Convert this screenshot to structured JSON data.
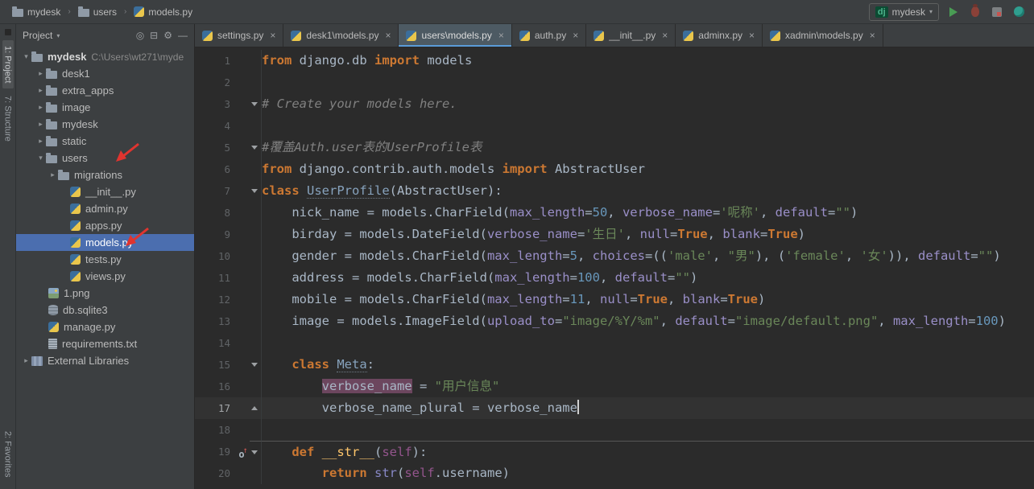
{
  "colors": {
    "panel_bg": "#3c3f41",
    "editor_bg": "#2b2b2b",
    "selection_blue": "#4b6eaf",
    "tab_underline": "#5a9bd8",
    "keyword": "#cc7832",
    "string": "#6a8759",
    "comment": "#808080",
    "number": "#6897bb",
    "kwarg": "#9a8fc8",
    "annotation_red": "#e0342f",
    "occurrence_highlight": "#e678be"
  },
  "ui": {
    "breadcrumb_separator": "›",
    "tab_close": "×",
    "chevron_expanded": "▾",
    "chevron_collapsed": "▸",
    "dropdown_arrow": "▾"
  },
  "top_bar": {
    "breadcrumbs": [
      {
        "label": "mydesk",
        "icon": "folder"
      },
      {
        "label": "users",
        "icon": "folder"
      },
      {
        "label": "models.py",
        "icon": "python"
      }
    ],
    "run_config": {
      "badge": "dj",
      "label": "mydesk"
    },
    "actions": [
      {
        "name": "run"
      },
      {
        "name": "debug"
      },
      {
        "name": "coverage"
      },
      {
        "name": "profiler"
      }
    ]
  },
  "tool_stripe": {
    "top": [
      "1: Project",
      "7: Structure"
    ],
    "bottom": [
      "2: Favorites"
    ]
  },
  "project_panel": {
    "title": "Project",
    "header_icons": [
      "locate",
      "collapse-all",
      "settings",
      "hide"
    ],
    "tree": [
      {
        "label": "mydesk",
        "suffix": "C:\\Users\\wt271\\myde",
        "pad": 6,
        "chev": "open",
        "icon": "folder",
        "bold": true
      },
      {
        "label": "desk1",
        "pad": 24,
        "chev": "closed",
        "icon": "folder"
      },
      {
        "label": "extra_apps",
        "pad": 24,
        "chev": "closed",
        "icon": "folder"
      },
      {
        "label": "image",
        "pad": 24,
        "chev": "closed",
        "icon": "folder"
      },
      {
        "label": "mydesk",
        "pad": 24,
        "chev": "closed",
        "icon": "folder"
      },
      {
        "label": "static",
        "pad": 24,
        "chev": "closed",
        "icon": "folder"
      },
      {
        "label": "users",
        "pad": 24,
        "chev": "open",
        "icon": "folder"
      },
      {
        "label": "migrations",
        "pad": 39,
        "chev": "closed",
        "icon": "folder"
      },
      {
        "label": "__init__.py",
        "pad": 67,
        "icon": "python"
      },
      {
        "label": "admin.py",
        "pad": 67,
        "icon": "python"
      },
      {
        "label": "apps.py",
        "pad": 67,
        "icon": "python"
      },
      {
        "label": "models.py",
        "pad": 67,
        "icon": "python",
        "selected": true
      },
      {
        "label": "tests.py",
        "pad": 67,
        "icon": "python"
      },
      {
        "label": "views.py",
        "pad": 67,
        "icon": "python"
      },
      {
        "label": "1.png",
        "pad": 40,
        "icon": "image"
      },
      {
        "label": "db.sqlite3",
        "pad": 40,
        "icon": "database"
      },
      {
        "label": "manage.py",
        "pad": 40,
        "icon": "python"
      },
      {
        "label": "requirements.txt",
        "pad": 40,
        "icon": "text"
      },
      {
        "label": "External Libraries",
        "pad": 6,
        "chev": "closed",
        "icon": "library"
      }
    ]
  },
  "tabs": [
    {
      "label": "settings.py"
    },
    {
      "label": "desk1\\models.py"
    },
    {
      "label": "users\\models.py",
      "active": true
    },
    {
      "label": "auth.py"
    },
    {
      "label": "__init__.py"
    },
    {
      "label": "adminx.py"
    },
    {
      "label": "xadmin\\models.py"
    }
  ],
  "editor": {
    "lines": [
      {
        "n": 1,
        "t": [
          [
            "k",
            "from"
          ],
          [
            "p",
            " django.db "
          ],
          [
            "k",
            "import"
          ],
          [
            "p",
            " models"
          ]
        ]
      },
      {
        "n": 2,
        "t": []
      },
      {
        "n": 3,
        "fold": "down",
        "t": [
          [
            "c",
            "# Create your models here."
          ]
        ]
      },
      {
        "n": 4,
        "t": []
      },
      {
        "n": 5,
        "fold": "down",
        "t": [
          [
            "c",
            "#覆盖Auth.user表的UserProfile表"
          ]
        ]
      },
      {
        "n": 6,
        "t": [
          [
            "k",
            "from"
          ],
          [
            "p",
            " django.contrib.auth.models "
          ],
          [
            "k",
            "import"
          ],
          [
            "p",
            " AbstractUser"
          ]
        ]
      },
      {
        "n": 7,
        "fold": "down",
        "t": [
          [
            "k",
            "class"
          ],
          [
            "p",
            " "
          ],
          [
            "cd",
            "UserProfile"
          ],
          [
            "p",
            "(AbstractUser):"
          ]
        ]
      },
      {
        "n": 8,
        "t": [
          [
            "p",
            "    nick_name = models.CharField("
          ],
          [
            "a",
            "max_length"
          ],
          [
            "p",
            "="
          ],
          [
            "n",
            "50"
          ],
          [
            "p",
            ", "
          ],
          [
            "a",
            "verbose_name"
          ],
          [
            "p",
            "="
          ],
          [
            "s",
            "'呢称'"
          ],
          [
            "p",
            ", "
          ],
          [
            "a",
            "default"
          ],
          [
            "p",
            "="
          ],
          [
            "s",
            "\"\""
          ],
          [
            "p",
            ")"
          ]
        ]
      },
      {
        "n": 9,
        "t": [
          [
            "p",
            "    birday = models.DateField("
          ],
          [
            "a",
            "verbose_name"
          ],
          [
            "p",
            "="
          ],
          [
            "s",
            "'生日'"
          ],
          [
            "p",
            ", "
          ],
          [
            "a",
            "null"
          ],
          [
            "p",
            "="
          ],
          [
            "k",
            "True"
          ],
          [
            "p",
            ", "
          ],
          [
            "a",
            "blank"
          ],
          [
            "p",
            "="
          ],
          [
            "k",
            "True"
          ],
          [
            "p",
            ")"
          ]
        ]
      },
      {
        "n": 10,
        "t": [
          [
            "p",
            "    gender = models.CharField("
          ],
          [
            "a",
            "max_length"
          ],
          [
            "p",
            "="
          ],
          [
            "n",
            "5"
          ],
          [
            "p",
            ", "
          ],
          [
            "a",
            "choices"
          ],
          [
            "p",
            "=(("
          ],
          [
            "s",
            "'male'"
          ],
          [
            "p",
            ", "
          ],
          [
            "s",
            "\"男\""
          ],
          [
            "p",
            "), ("
          ],
          [
            "s",
            "'female'"
          ],
          [
            "p",
            ", "
          ],
          [
            "s",
            "'女'"
          ],
          [
            "p",
            ")), "
          ],
          [
            "a",
            "default"
          ],
          [
            "p",
            "="
          ],
          [
            "s",
            "\"\""
          ],
          [
            "p",
            ")"
          ]
        ]
      },
      {
        "n": 11,
        "t": [
          [
            "p",
            "    address = models.CharField("
          ],
          [
            "a",
            "max_length"
          ],
          [
            "p",
            "="
          ],
          [
            "n",
            "100"
          ],
          [
            "p",
            ", "
          ],
          [
            "a",
            "default"
          ],
          [
            "p",
            "="
          ],
          [
            "s",
            "\"\""
          ],
          [
            "p",
            ")"
          ]
        ]
      },
      {
        "n": 12,
        "t": [
          [
            "p",
            "    mobile = models.CharField("
          ],
          [
            "a",
            "max_length"
          ],
          [
            "p",
            "="
          ],
          [
            "n",
            "11"
          ],
          [
            "p",
            ", "
          ],
          [
            "a",
            "null"
          ],
          [
            "p",
            "="
          ],
          [
            "k",
            "True"
          ],
          [
            "p",
            ", "
          ],
          [
            "a",
            "blank"
          ],
          [
            "p",
            "="
          ],
          [
            "k",
            "True"
          ],
          [
            "p",
            ")"
          ]
        ]
      },
      {
        "n": 13,
        "t": [
          [
            "p",
            "    image = models.ImageField("
          ],
          [
            "a",
            "upload_to"
          ],
          [
            "p",
            "="
          ],
          [
            "s",
            "\"image/%Y/%m\""
          ],
          [
            "p",
            ", "
          ],
          [
            "a",
            "default"
          ],
          [
            "p",
            "="
          ],
          [
            "s",
            "\"image/default.png\""
          ],
          [
            "p",
            ", "
          ],
          [
            "a",
            "max_length"
          ],
          [
            "p",
            "="
          ],
          [
            "n",
            "100"
          ],
          [
            "p",
            ")"
          ]
        ]
      },
      {
        "n": 14,
        "t": []
      },
      {
        "n": 15,
        "fold": "down",
        "t": [
          [
            "p",
            "    "
          ],
          [
            "k",
            "class"
          ],
          [
            "p",
            " "
          ],
          [
            "cd",
            "Meta"
          ],
          [
            "p",
            ":"
          ]
        ]
      },
      {
        "n": 16,
        "t": [
          [
            "p",
            "        "
          ],
          [
            "hl",
            "verbose_name"
          ],
          [
            "p",
            " = "
          ],
          [
            "s",
            "\"用户信息\""
          ]
        ]
      },
      {
        "n": 17,
        "current": true,
        "fold": "up",
        "t": [
          [
            "p",
            "        verbose_name_plural = verbose_name"
          ],
          [
            "caret",
            ""
          ]
        ]
      },
      {
        "n": 18,
        "t": []
      },
      {
        "n": 19,
        "sep": true,
        "icon": "override",
        "fold": "down",
        "t": [
          [
            "p",
            "    "
          ],
          [
            "k",
            "def"
          ],
          [
            "p",
            " "
          ],
          [
            "fd",
            "__str__"
          ],
          [
            "p",
            "("
          ],
          [
            "sf",
            "self"
          ],
          [
            "p",
            "):"
          ]
        ]
      },
      {
        "n": 20,
        "t": [
          [
            "p",
            "        "
          ],
          [
            "k",
            "return"
          ],
          [
            "p",
            " "
          ],
          [
            "b",
            "str"
          ],
          [
            "p",
            "("
          ],
          [
            "sf",
            "self"
          ],
          [
            "p",
            ".username)"
          ]
        ]
      }
    ]
  }
}
